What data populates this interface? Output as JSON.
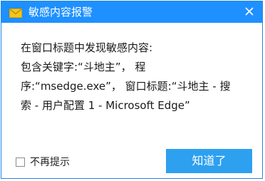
{
  "window": {
    "title": "敏感内容报警",
    "title_icon": "envelope-icon",
    "close_icon": "close-icon"
  },
  "message": {
    "line1": "在窗口标题中发现敏感内容:",
    "line2": "包含关键字:“斗地主”， 程",
    "line3": "序:“msedge.exe”， 窗口标题:“斗地主 - 搜",
    "line4": "索 - 用户配置 1 - Microsoft Edge”"
  },
  "footer": {
    "checkbox_label": "不再提示",
    "checkbox_checked": false,
    "ok_button_label": "知道了"
  },
  "colors": {
    "titlebar": "#1e90ff",
    "button": "#2ea0f0",
    "icon_envelope": "#f5c518"
  }
}
